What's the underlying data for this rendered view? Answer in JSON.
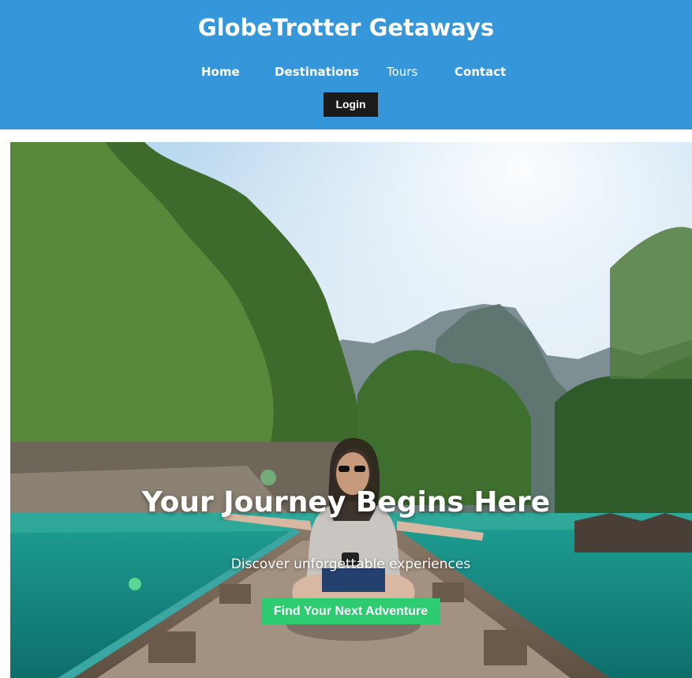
{
  "header": {
    "title": "GlobeTrotter Getaways",
    "background_color": "#3596d9"
  },
  "nav": {
    "items": [
      {
        "label": "Home"
      },
      {
        "label": "Destinations"
      },
      {
        "label": "Tours"
      },
      {
        "label": "Contact"
      }
    ],
    "login_label": "Login"
  },
  "hero": {
    "title": "Your Journey Begins Here",
    "subtitle": "Discover unforgettable experiences",
    "cta_label": "Find Your Next Adventure",
    "cta_color": "#2ecc71"
  }
}
